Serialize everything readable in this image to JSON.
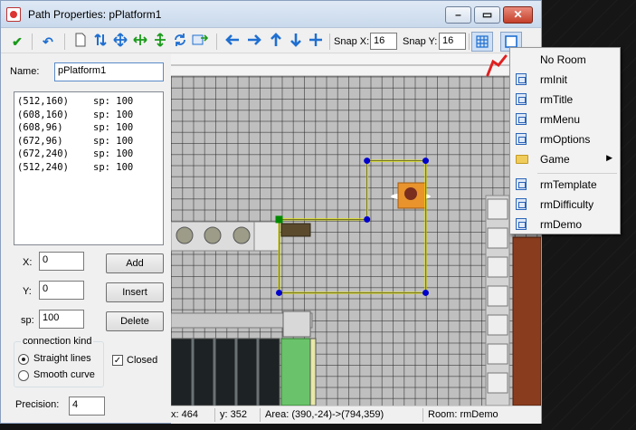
{
  "window": {
    "title": "Path Properties: pPlatform1",
    "minimize_glyph": "–",
    "maximize_glyph": "▭",
    "close_glyph": "✕"
  },
  "toolbar": {
    "ok_icon": "✔",
    "undo_icon": "↶",
    "snap_x_label": "Snap X:",
    "snap_x_value": "16",
    "snap_y_label": "Snap Y:",
    "snap_y_value": "16",
    "accent": "#1f6fd1"
  },
  "left": {
    "name_label": "Name:",
    "name_value": "pPlatform1",
    "points": [
      {
        "coord": "(512,160)",
        "sp": "sp: 100"
      },
      {
        "coord": "(608,160)",
        "sp": "sp: 100"
      },
      {
        "coord": "(608,96)",
        "sp": "sp: 100"
      },
      {
        "coord": "(672,96)",
        "sp": "sp: 100"
      },
      {
        "coord": "(672,240)",
        "sp": "sp: 100"
      },
      {
        "coord": "(512,240)",
        "sp": "sp: 100"
      }
    ],
    "x_label": "X:",
    "x_value": "0",
    "y_label": "Y:",
    "y_value": "0",
    "sp_label": "sp:",
    "sp_value": "100",
    "add_label": "Add",
    "insert_label": "Insert",
    "delete_label": "Delete",
    "connection_title": "connection kind",
    "straight_label": "Straight lines",
    "smooth_label": "Smooth curve",
    "closed_label": "Closed",
    "precision_label": "Precision:",
    "precision_value": "4"
  },
  "status": {
    "x": "x: 464",
    "y": "y: 352",
    "area": "Area: (390,-24)->(794,359)",
    "room": "Room: rmDemo"
  },
  "menu": {
    "items": [
      {
        "label": "No Room",
        "icon": "none"
      },
      {
        "label": "rmInit",
        "icon": "room-icon"
      },
      {
        "label": "rmTitle",
        "icon": "room-icon"
      },
      {
        "label": "rmMenu",
        "icon": "room-icon"
      },
      {
        "label": "rmOptions",
        "icon": "room-icon"
      },
      {
        "label": "Game",
        "icon": "folder-icon",
        "submenu": true
      },
      {
        "label": "rmTemplate",
        "icon": "room-icon"
      },
      {
        "label": "rmDifficulty",
        "icon": "room-icon"
      },
      {
        "label": "rmDemo",
        "icon": "room-icon"
      }
    ],
    "submenu_arrow": "▶"
  },
  "canvas": {
    "path_color": "#e6e600",
    "node_color": "#0000cc",
    "start_node_color": "#008800",
    "annotation_color": "#e02020"
  }
}
